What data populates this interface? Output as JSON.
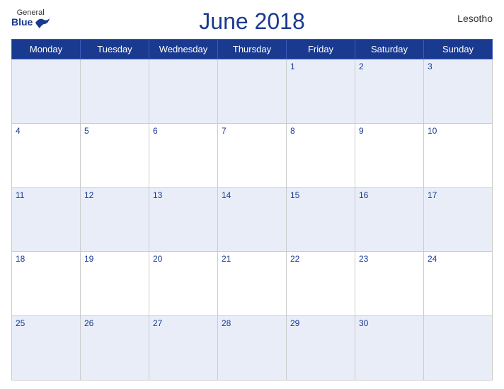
{
  "header": {
    "title": "June 2018",
    "country": "Lesotho",
    "logo": {
      "general": "General",
      "blue": "Blue"
    }
  },
  "weekdays": [
    "Monday",
    "Tuesday",
    "Wednesday",
    "Thursday",
    "Friday",
    "Saturday",
    "Sunday"
  ],
  "weeks": [
    [
      null,
      null,
      null,
      null,
      1,
      2,
      3
    ],
    [
      4,
      5,
      6,
      7,
      8,
      9,
      10
    ],
    [
      11,
      12,
      13,
      14,
      15,
      16,
      17
    ],
    [
      18,
      19,
      20,
      21,
      22,
      23,
      24
    ],
    [
      25,
      26,
      27,
      28,
      29,
      30,
      null
    ]
  ]
}
